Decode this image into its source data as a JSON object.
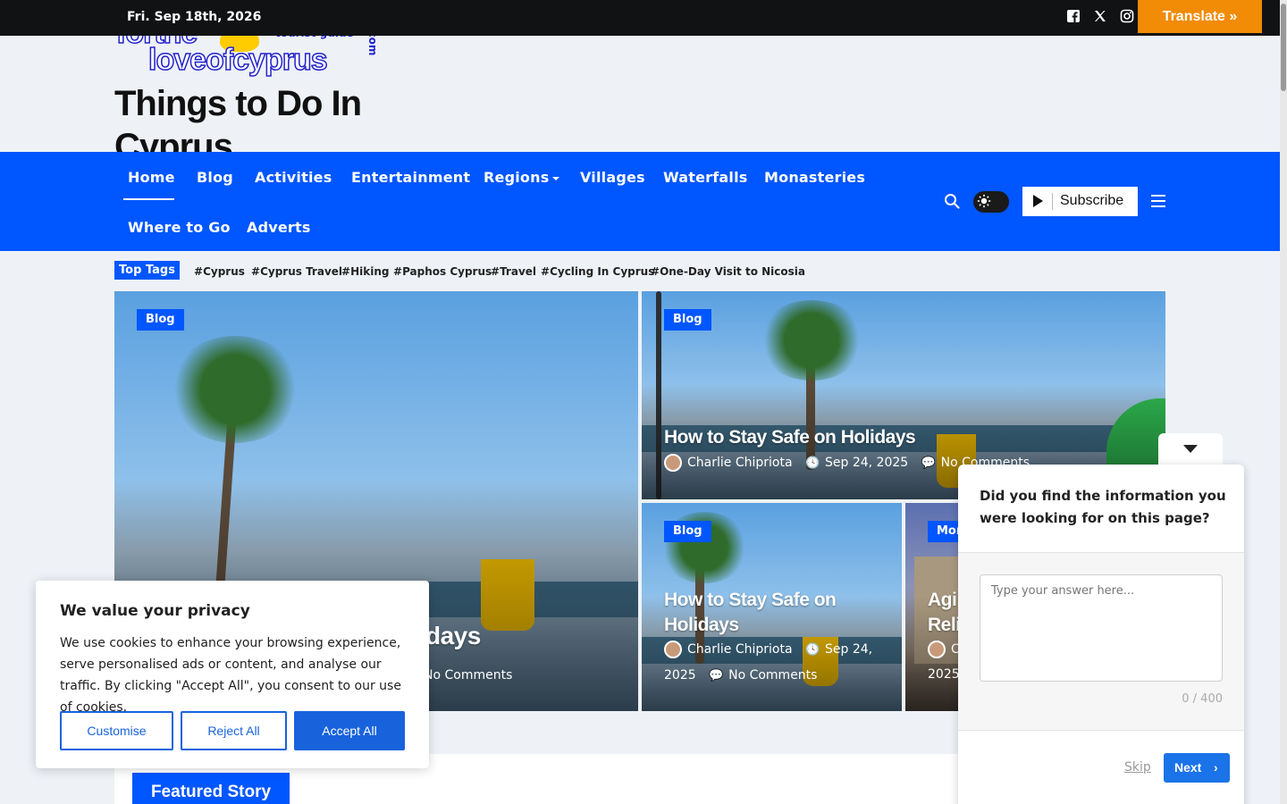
{
  "topbar": {
    "date": "Fri. Sep 18th, 2026",
    "social_icons": [
      "facebook-icon",
      "x-twitter-icon",
      "instagram-icon"
    ],
    "translate_label": "Translate »"
  },
  "logo": {
    "line1": "forthe",
    "tag": "tourist guide",
    "line2": "loveofcyprus",
    "suffix": ".com"
  },
  "site_title": "Things to Do In Cyprus",
  "nav": {
    "items": [
      "Home",
      "Blog",
      "Activities",
      "Entertainment",
      "Regions",
      "Villages",
      "Waterfalls",
      "Monasteries",
      "Where to Go",
      "Adverts"
    ],
    "active": "Home",
    "subscribe_label": "Subscribe"
  },
  "tags": {
    "label": "Top Tags",
    "items": [
      "Cyprus",
      "Cyprus Travel",
      "Hiking",
      "Paphos Cyprus",
      "Travel",
      "Cycling In Cyprus",
      "One-Day Visit to Nicosia"
    ]
  },
  "hero": {
    "main": {
      "category": "Blog",
      "title_visible": "days",
      "comments": "No Comments"
    },
    "top_right": {
      "category": "Blog",
      "title": "How to Stay Safe on Holidays",
      "author": "Charlie Chipriota",
      "date": "Sep 24, 2025",
      "comments": "No Comments"
    },
    "bottom_left": {
      "category": "Blog",
      "title": "How to Stay Safe on Holidays",
      "author": "Charlie Chipriota",
      "date_a": "Sep 24,",
      "date_b": "2025",
      "comments": "No Comments"
    },
    "bottom_right": {
      "category": "Mon",
      "title_a": "Agi",
      "title_b": "Reli",
      "author": "C",
      "date_b": "2025"
    }
  },
  "featured": {
    "label": "Featured Story"
  },
  "cookie": {
    "title": "We value your privacy",
    "text": "We use cookies to enhance your browsing experience, serve personalised ads or content, and analyse our traffic. By clicking \"Accept All\", you consent to our use of cookies.",
    "customise": "Customise",
    "reject": "Reject All",
    "accept": "Accept All"
  },
  "survey": {
    "question": "Did you find the information you were looking for on this page?",
    "placeholder": "Type your answer here...",
    "counter": "0 / 400",
    "skip": "Skip",
    "next": "Next"
  },
  "colors": {
    "nav_blue": "#0056ff",
    "translate_orange": "#f28b05",
    "cookie_blue": "#1863dc",
    "survey_next": "#1a73e8"
  }
}
